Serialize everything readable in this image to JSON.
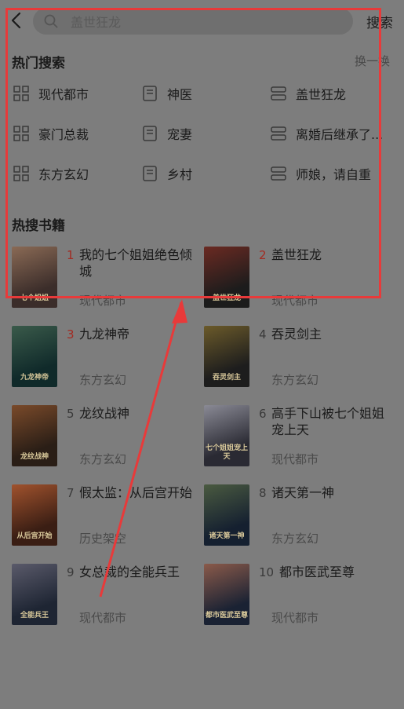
{
  "header": {
    "search_placeholder": "盖世狂龙",
    "search_label": "搜索"
  },
  "hot_search": {
    "title": "热门搜索",
    "refresh_label": "换一换",
    "items": [
      {
        "label": "现代都市",
        "icon": "grid-icon"
      },
      {
        "label": "神医",
        "icon": "book-icon"
      },
      {
        "label": "盖世狂龙",
        "icon": "stack-icon"
      },
      {
        "label": "豪门总裁",
        "icon": "grid-icon"
      },
      {
        "label": "宠妻",
        "icon": "book-icon"
      },
      {
        "label": "离婚后继承了...",
        "icon": "stack-icon"
      },
      {
        "label": "东方玄幻",
        "icon": "grid-icon"
      },
      {
        "label": "乡村",
        "icon": "book-icon"
      },
      {
        "label": "师娘，请自重",
        "icon": "stack-icon"
      }
    ]
  },
  "hot_books": {
    "title": "热搜书籍",
    "books": [
      {
        "rank": "1",
        "title": "我的七个姐姐绝色倾城",
        "category": "现代都市",
        "cover_text": "七个姐姐"
      },
      {
        "rank": "2",
        "title": "盖世狂龙",
        "category": "现代都市",
        "cover_text": "盖世狂龙"
      },
      {
        "rank": "3",
        "title": "九龙神帝",
        "category": "东方玄幻",
        "cover_text": "九龙神帝"
      },
      {
        "rank": "4",
        "title": "吞灵剑主",
        "category": "东方玄幻",
        "cover_text": "吞灵剑主"
      },
      {
        "rank": "5",
        "title": "龙纹战神",
        "category": "东方玄幻",
        "cover_text": "龙纹战神"
      },
      {
        "rank": "6",
        "title": "高手下山被七个姐姐宠上天",
        "category": "现代都市",
        "cover_text": "七个姐姐宠上天"
      },
      {
        "rank": "7",
        "title": "假太监：从后宫开始",
        "category": "历史架空",
        "cover_text": "从后宫开始"
      },
      {
        "rank": "8",
        "title": "诸天第一神",
        "category": "东方玄幻",
        "cover_text": "诸天第一神"
      },
      {
        "rank": "9",
        "title": "女总裁的全能兵王",
        "category": "现代都市",
        "cover_text": "全能兵王"
      },
      {
        "rank": "10",
        "title": "都市医武至尊",
        "category": "现代都市",
        "cover_text": "都市医武至尊"
      }
    ]
  },
  "colors": {
    "overlay": "#7d7d7d",
    "rank_highlight": "#a32b22",
    "annotation": "#e83a3a"
  }
}
